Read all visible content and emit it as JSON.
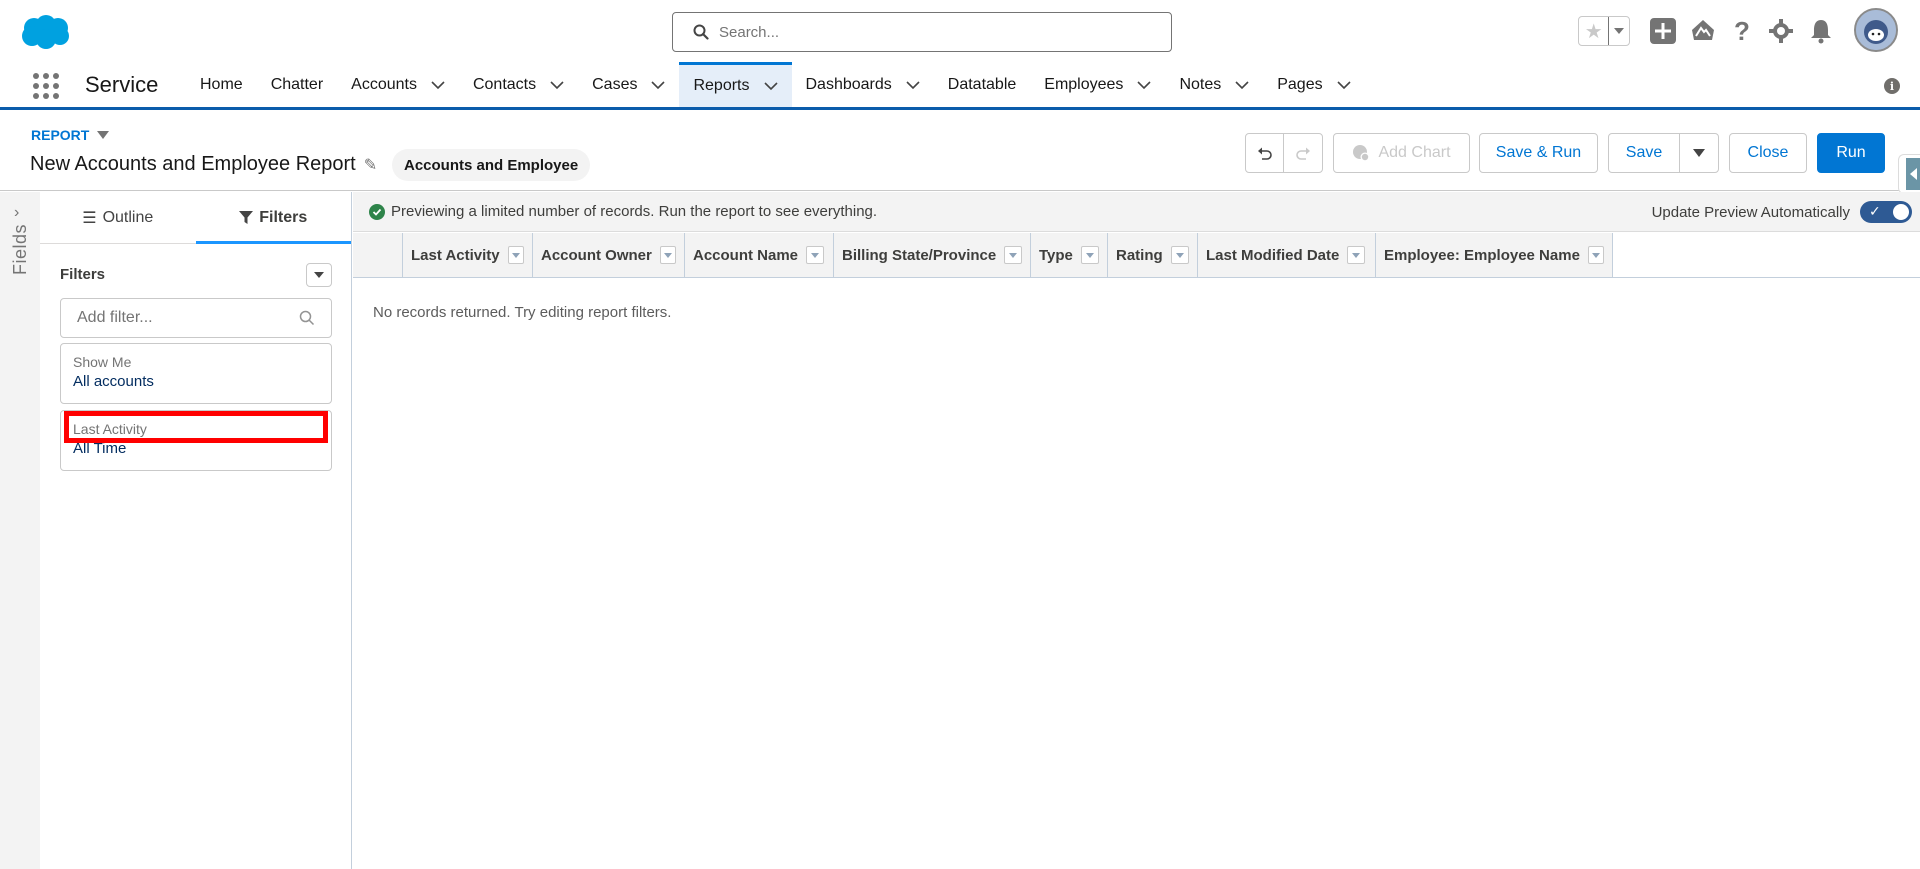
{
  "global_header": {
    "search_placeholder": "Search...",
    "icons": [
      "favorites-star-icon",
      "favorites-dropdown-icon",
      "global-create-icon",
      "trailhead-icon",
      "help-icon",
      "setup-gear-icon",
      "notifications-bell-icon",
      "user-avatar"
    ]
  },
  "nav": {
    "app_name": "Service",
    "items": [
      {
        "label": "Home",
        "has_menu": false
      },
      {
        "label": "Chatter",
        "has_menu": false
      },
      {
        "label": "Accounts",
        "has_menu": true
      },
      {
        "label": "Contacts",
        "has_menu": true
      },
      {
        "label": "Cases",
        "has_menu": true
      },
      {
        "label": "Reports",
        "has_menu": true,
        "active": true
      },
      {
        "label": "Dashboards",
        "has_menu": true
      },
      {
        "label": "Datatable",
        "has_menu": false
      },
      {
        "label": "Employees",
        "has_menu": true
      },
      {
        "label": "Notes",
        "has_menu": true
      },
      {
        "label": "Pages",
        "has_menu": true
      }
    ]
  },
  "report": {
    "type_label": "REPORT",
    "title": "New Accounts and Employee Report",
    "report_type_pill": "Accounts and Employee",
    "buttons": {
      "add_chart": "Add Chart",
      "save_and_run": "Save & Run",
      "save": "Save",
      "close": "Close",
      "run": "Run"
    }
  },
  "fields_rail": {
    "label": "Fields"
  },
  "left_panel": {
    "tabs": [
      {
        "label": "Outline",
        "active": false
      },
      {
        "label": "Filters",
        "active": true
      }
    ],
    "filters_heading": "Filters",
    "add_filter_placeholder": "Add filter...",
    "filters": [
      {
        "label": "Show Me",
        "value": "All accounts"
      },
      {
        "label": "Last Activity",
        "value": "All Time",
        "highlighted": true
      }
    ]
  },
  "preview": {
    "notice": "Previewing a limited number of records. Run the report to see everything.",
    "auto_update_label": "Update Preview Automatically",
    "auto_update_on": true,
    "columns": [
      "Last Activity",
      "Account Owner",
      "Account Name",
      "Billing State/Province",
      "Type",
      "Rating",
      "Last Modified Date",
      "Employee: Employee Name"
    ],
    "empty_message": "No records returned. Try editing report filters."
  },
  "colors": {
    "brand": "#0176d3",
    "nav_active_bg": "#e5eef9",
    "highlight": "#ff0000",
    "success": "#2e844a",
    "toggle": "#2e5a94"
  }
}
